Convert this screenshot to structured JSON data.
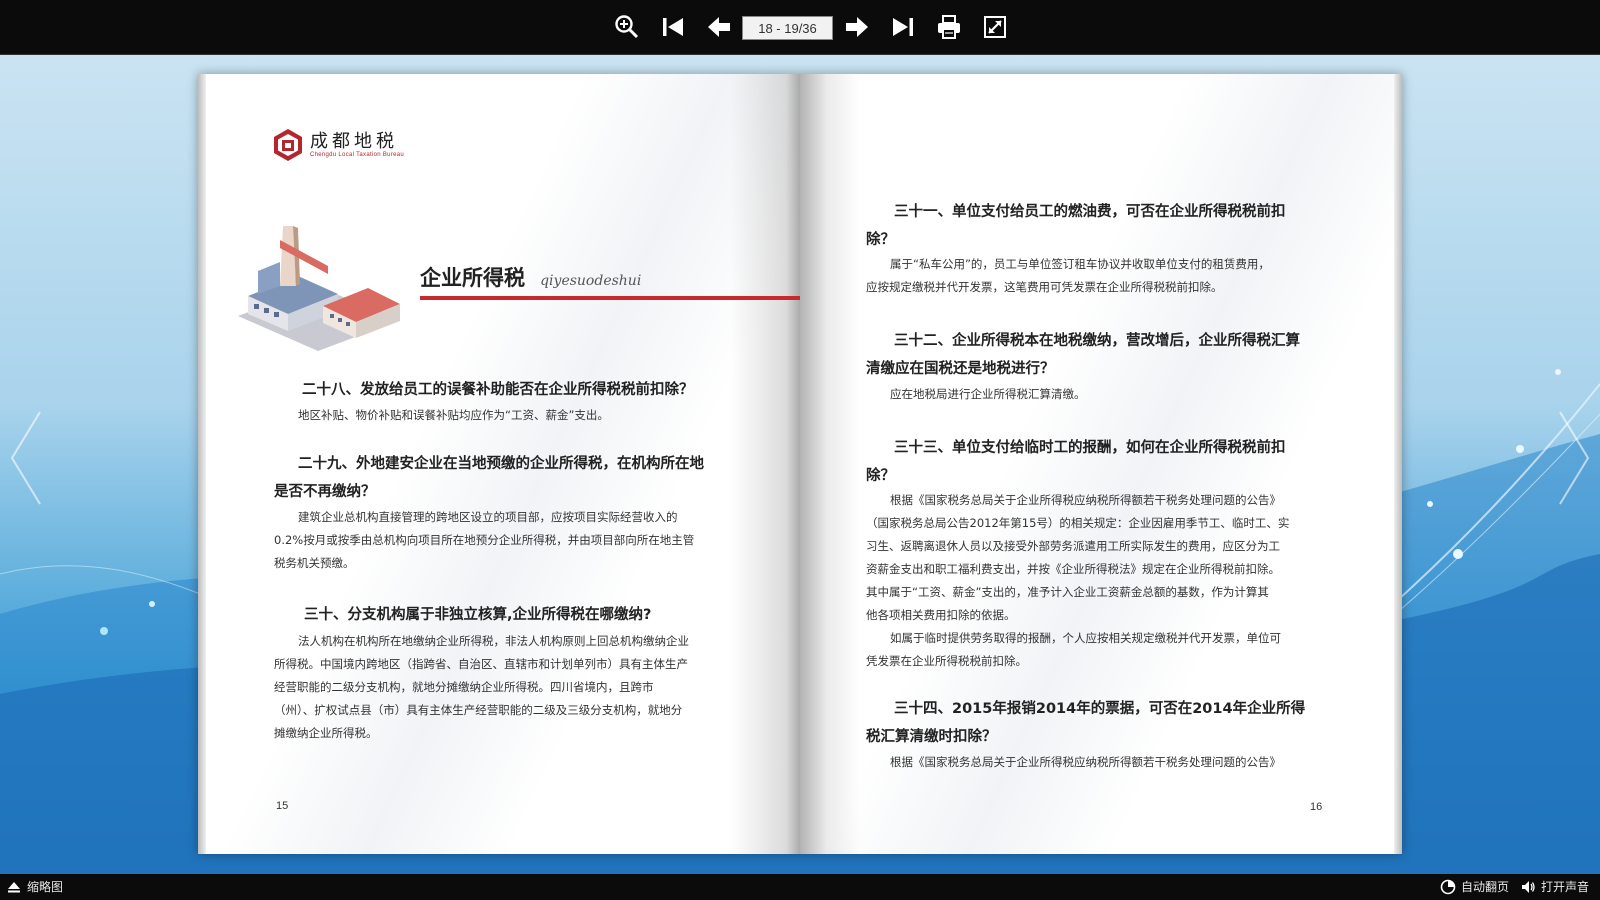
{
  "toolbar": {
    "page_indicator": "18 - 19/36",
    "buttons": [
      "zoom-in-icon",
      "first-page-icon",
      "prev-page-icon",
      "next-page-icon",
      "last-page-icon",
      "print-icon",
      "fullscreen-icon"
    ]
  },
  "left_page": {
    "logo_cn": "成都地税",
    "logo_en": "Chengdu Local Taxation Bureau",
    "section_title": "企业所得税",
    "section_pinyin": "qiyesuodeshui",
    "q28": "二十八、发放给员工的误餐补助能否在企业所得税税前扣除？",
    "a28": "地区补贴、物价补贴和误餐补贴均应作为“工资、薪金”支出。",
    "q29_line1": "二十九、外地建安企业在当地预缴的企业所得税，在机构所在地",
    "q29_line2": "是否不再缴纳？",
    "a29_line1": "建筑企业总机构直接管理的跨地区设立的项目部，应按项目实际经营收入的",
    "a29_line2": "0.2%按月或按季由总机构向项目所在地预分企业所得税，并由项目部向所在地主管",
    "a29_line3": "税务机关预缴。",
    "q30": "三十、分支机构属于非独立核算,企业所得税在哪缴纳?",
    "a30_line1": "法人机构在机构所在地缴纳企业所得税，非法人机构原则上回总机构缴纳企业",
    "a30_line2": "所得税。中国境内跨地区（指跨省、自治区、直辖市和计划单列市）具有主体生产",
    "a30_line3": "经营职能的二级分支机构，就地分摊缴纳企业所得税。四川省境内，且跨市",
    "a30_line4": "（州）、扩权试点县（市）具有主体生产经营职能的二级及三级分支机构，就地分",
    "a30_line5": "摊缴纳企业所得税。",
    "page_number": "15"
  },
  "right_page": {
    "q31_line1": "三十一、单位支付给员工的燃油费，可否在企业所得税税前扣",
    "q31_line2": "除？",
    "a31_line1": "属于“私车公用”的，员工与单位签订租车协议并收取单位支付的租赁费用，",
    "a31_line2": "应按规定缴税并代开发票，这笔费用可凭发票在企业所得税税前扣除。",
    "q32_line1": "三十二、企业所得税本在地税缴纳，营改增后，企业所得税汇算",
    "q32_line2": "清缴应在国税还是地税进行？",
    "a32": "应在地税局进行企业所得税汇算清缴。",
    "q33_line1": "三十三、单位支付给临时工的报酬，如何在企业所得税税前扣",
    "q33_line2": "除？",
    "a33_line1": "根据《国家税务总局关于企业所得税应纳税所得额若干税务处理问题的公告》",
    "a33_line2": "（国家税务总局公告2012年第15号）的相关规定：企业因雇用季节工、临时工、实",
    "a33_line3": "习生、返聘离退休人员以及接受外部劳务派遣用工所实际发生的费用，应区分为工",
    "a33_line4": "资薪金支出和职工福利费支出，并按《企业所得税法》规定在企业所得税前扣除。",
    "a33_line5": "其中属于“工资、薪金”支出的，准予计入企业工资薪金总额的基数，作为计算其",
    "a33_line6": "他各项相关费用扣除的依据。",
    "a33_line7": "如属于临时提供劳务取得的报酬，个人应按相关规定缴税并代开发票，单位可",
    "a33_line8": "凭发票在企业所得税税前扣除。",
    "q34_line1": "三十四、2015年报销2014年的票据，可否在2014年企业所得",
    "q34_line2": "税汇算清缴时扣除？",
    "a34_line1": "根据《国家税务总局关于企业所得税应纳税所得额若干税务处理问题的公告》",
    "page_number": "16"
  },
  "bottom": {
    "thumbnails": "缩略图",
    "auto_flip": "自动翻页",
    "sound": "打开声音"
  },
  "colors": {
    "accent_red": "#c62a2f",
    "toolbar_bg": "#0b0b0b"
  }
}
